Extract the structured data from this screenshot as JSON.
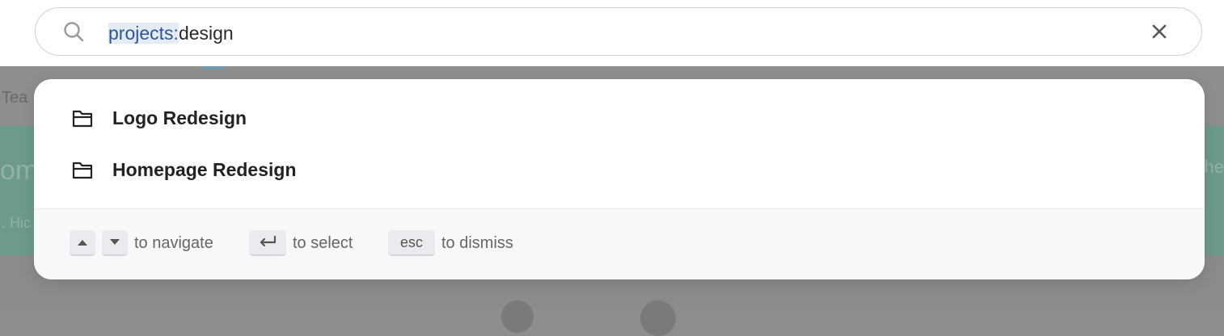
{
  "search": {
    "token": "projects:",
    "term": "design"
  },
  "results": [
    {
      "label": "Logo Redesign",
      "icon": "folder-icon"
    },
    {
      "label": "Homepage Redesign",
      "icon": "folder-icon"
    }
  ],
  "footer": {
    "navigate_text": "to navigate",
    "select_text": "to select",
    "esc_key": "esc",
    "dismiss_text": "to dismiss"
  },
  "background": {
    "tabs_fragment": "Tea",
    "banner_fragment": "om",
    "banner_sub_fragment": ". Hic",
    "banner_right_fragment": "che"
  },
  "colors": {
    "token_highlight": "#e4ebf5",
    "token_text": "#2f5694",
    "overlay": "#8d8d8d"
  }
}
